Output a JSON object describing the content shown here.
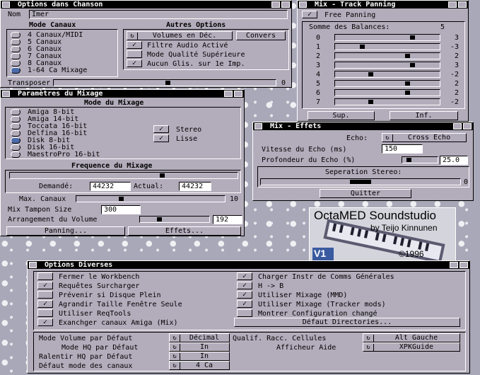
{
  "chanson": {
    "title": "Options dans Chanson",
    "name_label": "Nom",
    "name_value": "Imer",
    "mode_canaux_title": "Mode Canaux",
    "modes": [
      "4 Canaux/MIDI",
      "5 Canaux",
      "6 Canaux",
      "7 Canaux",
      "8 Canaux",
      "1-64 Ca Mixage"
    ],
    "autres_title": "Autres Options",
    "volumes_label": "Volumes en Déc.",
    "convers_label": "Convers",
    "filtre_label": "Filtre Audio Activé",
    "mode_qualite_label": "Mode Qualité Supérieure",
    "aucun_glis_label": "Aucun Glis. sur 1e Imp.",
    "transposer_label": "Transposer",
    "transposer_value": "0"
  },
  "panning": {
    "title": "Mix - Track Panning",
    "free_panning_label": "Free Panning",
    "somme_label": "Somme des Balances:",
    "somme_value": "5",
    "tracks": [
      {
        "n": "0",
        "v": "3",
        "pos": 0.75
      },
      {
        "n": "1",
        "v": "-3",
        "pos": 0.25
      },
      {
        "n": "2",
        "v": "2",
        "pos": 0.7
      },
      {
        "n": "3",
        "v": "3",
        "pos": 0.75
      },
      {
        "n": "4",
        "v": "-2",
        "pos": 0.33
      },
      {
        "n": "5",
        "v": "2",
        "pos": 0.7
      },
      {
        "n": "6",
        "v": "2",
        "pos": 0.7
      },
      {
        "n": "7",
        "v": "-2",
        "pos": 0.33
      }
    ],
    "sup_label": "Sup.",
    "inf_label": "Inf."
  },
  "mixage": {
    "title": "Paramètres du Mixage",
    "mode_title": "Mode du Mixage",
    "modes": [
      "Amiga 8-bit",
      "Amiga 14-bit",
      "Toccata 16-bit",
      "Delfina 16-bit",
      "Disk 8-bit",
      "Disk 16-bit",
      "MaestroPro 16-bit"
    ],
    "stereo_label": "Stereo",
    "lisse_label": "Lisse",
    "freq_title": "Frequence du Mixage",
    "demande_label": "Demandé:",
    "demande_value": "44232",
    "actual_label": "Actual:",
    "actual_value": "44232",
    "max_canaux_label": "Max. Canaux",
    "max_canaux_value": "10",
    "tampon_label": "Mix Tampon Size",
    "tampon_value": "300",
    "arrangement_label": "Arrangement du Volume",
    "arrangement_value": "192",
    "panning_btn": "Panning...",
    "effets_btn": "Effets..."
  },
  "effets": {
    "title": "Mix - Effets",
    "echo_label": "Echo:",
    "echo_value": "Cross Echo",
    "vitesse_label": "Vitesse du Echo (ms)",
    "vitesse_value": "150",
    "profondeur_label": "Profondeur du Echo (%)",
    "profondeur_value": "25.0",
    "separation_label": "Seperation Stereo:",
    "separation_value": "0",
    "quitter_label": "Quitter"
  },
  "logo": {
    "line1": "OctaMED Soundstudio",
    "line2": "by Teijo Kinnunen",
    "ver": "V1",
    "year": "©1996"
  },
  "diverses": {
    "title": "Options Diverses",
    "left": [
      {
        "label": "Fermer le Workbench",
        "checked": false
      },
      {
        "label": "Requêtes Surcharger",
        "checked": true
      },
      {
        "label": "Prévenir si Disque Plein",
        "checked": false
      },
      {
        "label": "Agrandir Taille Fenêtre Seule",
        "checked": true
      },
      {
        "label": "Utiliser ReqTools",
        "checked": false
      },
      {
        "label": "Exanchger canaux Amiga (Mix)",
        "checked": true
      }
    ],
    "right": [
      {
        "label": "Charger Instr de Comms Générales",
        "checked": true
      },
      {
        "label": "H -> B",
        "checked": true
      },
      {
        "label": "Utiliser Mixage (MMD)",
        "checked": true
      },
      {
        "label": "Utiliser Mixage (Tracker mods)",
        "checked": true
      },
      {
        "label": "Montrer Configuration changé",
        "checked": false
      }
    ],
    "defaut_dirs": "Défaut Directories...",
    "mode_volume_label": "Mode Volume par Défaut",
    "mode_volume_value": "Décimal",
    "mode_hq_label": "Mode HQ par Défaut",
    "mode_hq_value": "In",
    "ralentir_label": "Ralentir HQ par Défaut",
    "ralentir_value": "In",
    "defaut_canaux_label": "Défaut mode des canaux",
    "defaut_canaux_value": "4 Ca",
    "qualif_label": "Qualif. Racc. Cellules",
    "qualif_value": "Alt Gauche",
    "afficheur_label": "Afficheur Aide",
    "afficheur_value": "XPKGuide"
  }
}
